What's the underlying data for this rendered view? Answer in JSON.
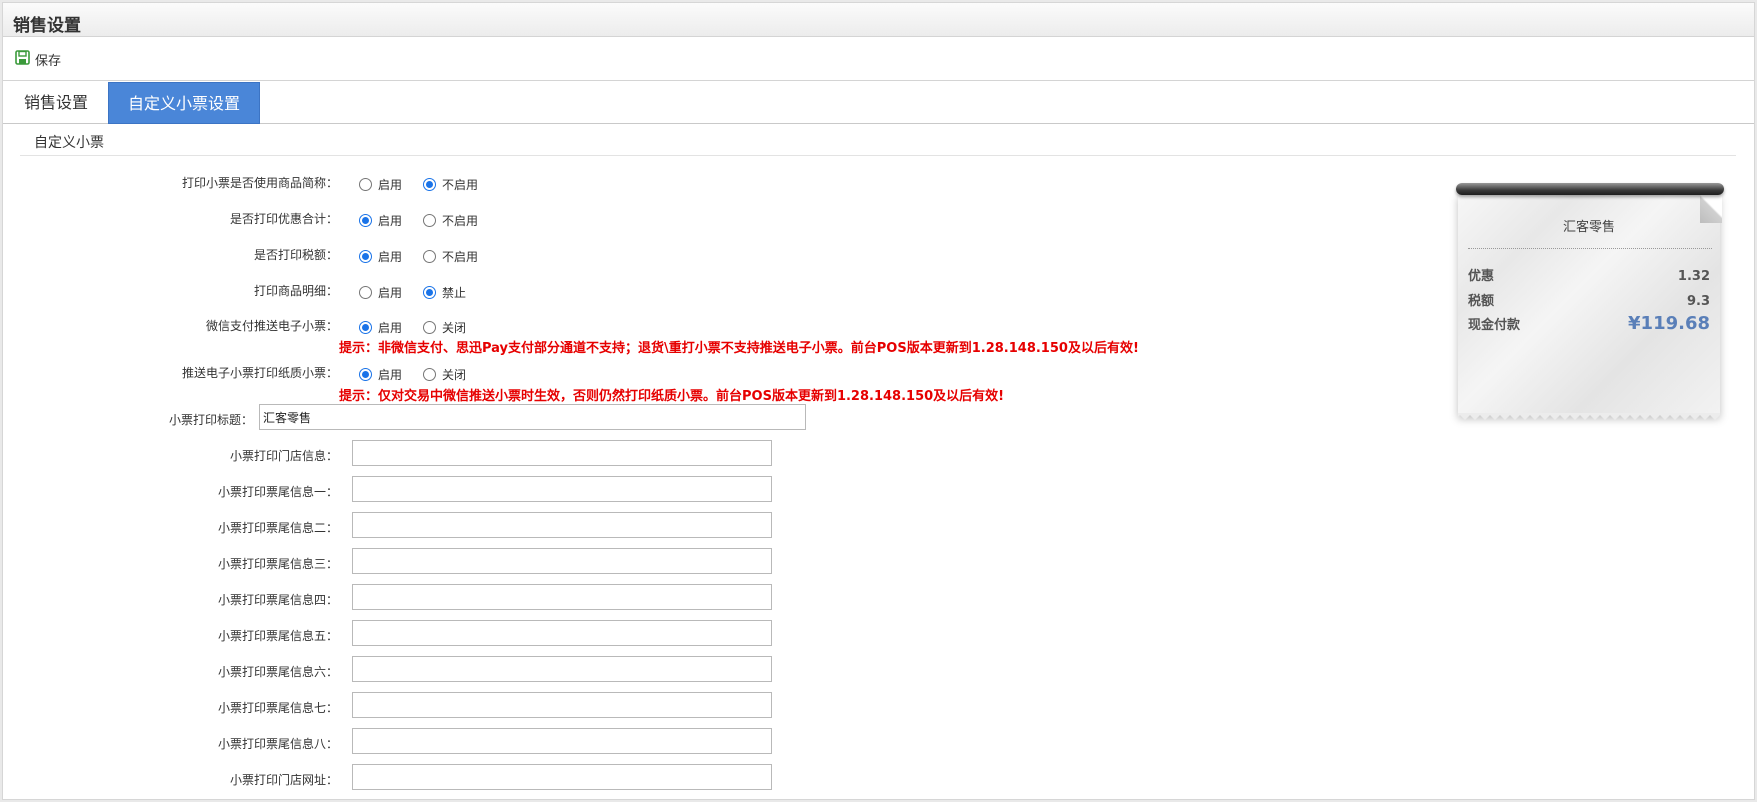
{
  "window": {
    "title": "销售设置"
  },
  "toolbar": {
    "save_label": "保存"
  },
  "tabs": [
    {
      "label": "销售设置",
      "active": false
    },
    {
      "label": "自定义小票设置",
      "active": true
    }
  ],
  "section": {
    "title": "自定义小票"
  },
  "radio_settings": [
    {
      "label": "打印小票是否使用商品简称：",
      "options": [
        "启用",
        "不启用"
      ],
      "selected": 1
    },
    {
      "label": "是否打印优惠合计：",
      "options": [
        "启用",
        "不启用"
      ],
      "selected": 0
    },
    {
      "label": "是否打印税额：",
      "options": [
        "启用",
        "不启用"
      ],
      "selected": 0
    },
    {
      "label": "打印商品明细：",
      "options": [
        "启用",
        "禁止"
      ],
      "selected": 1
    },
    {
      "label": "微信支付推送电子小票：",
      "options": [
        "启用",
        "关闭"
      ],
      "selected": 0
    },
    {
      "label": "推送电子小票打印纸质小票：",
      "options": [
        "启用",
        "关闭"
      ],
      "selected": 0
    }
  ],
  "hints": {
    "wechat_push": "提示：非微信支付、思迅Pay支付部分通道不支持；退货\\重打小票不支持推送电子小票。前台POS版本更新到1.28.148.150及以后有效!",
    "paper_print": "提示：仅对交易中微信推送小票时生效，否则仍然打印纸质小票。前台POS版本更新到1.28.148.150及以后有效!"
  },
  "title_field": {
    "label": "小票打印标题：",
    "value": "汇客零售"
  },
  "text_fields": [
    {
      "label": "小票打印门店信息：",
      "value": ""
    },
    {
      "label": "小票打印票尾信息一：",
      "value": ""
    },
    {
      "label": "小票打印票尾信息二：",
      "value": ""
    },
    {
      "label": "小票打印票尾信息三：",
      "value": ""
    },
    {
      "label": "小票打印票尾信息四：",
      "value": ""
    },
    {
      "label": "小票打印票尾信息五：",
      "value": ""
    },
    {
      "label": "小票打印票尾信息六：",
      "value": ""
    },
    {
      "label": "小票打印票尾信息七：",
      "value": ""
    },
    {
      "label": "小票打印票尾信息八：",
      "value": ""
    },
    {
      "label": "小票打印门店网址：",
      "value": ""
    }
  ],
  "receipt_preview": {
    "title": "汇客零售",
    "rows": [
      {
        "key": "优惠",
        "value": "1.32"
      },
      {
        "key": "税额",
        "value": "9.3"
      },
      {
        "key": "现金付款",
        "value": "¥119.68"
      }
    ]
  },
  "colors": {
    "tab_active": "#4a86d8",
    "hint": "#e60000",
    "radio_checked": "#1a73e8",
    "total_amount": "#5a7fb8",
    "save_icon": "#3a9a3a"
  }
}
